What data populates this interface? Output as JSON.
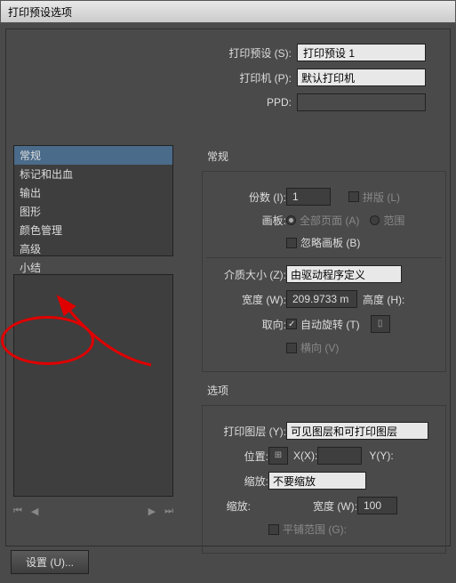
{
  "window": {
    "title": "打印预设选项"
  },
  "top": {
    "preset_label": "打印预设 (S):",
    "preset_value": "打印预设 1",
    "printer_label": "打印机 (P):",
    "printer_value": "默认打印机",
    "ppd_label": "PPD:"
  },
  "sidebar": {
    "items": [
      "常规",
      "标记和出血",
      "输出",
      "图形",
      "颜色管理",
      "高级",
      "小结"
    ]
  },
  "nav": {
    "first": "⏮",
    "prev": "◀",
    "next": "▶",
    "last": "⏭"
  },
  "general": {
    "title": "常规",
    "copies_label": "份数 (I):",
    "copies_value": "1",
    "collate_label": "拼版 (L)",
    "artboard_label": "画板:",
    "all_label": "全部页面 (A)",
    "range_label": "范围",
    "ignore_label": "忽略画板 (B)",
    "media_label": "介质大小 (Z):",
    "media_value": "由驱动程序定义",
    "width_label": "宽度 (W):",
    "width_value": "209.9733 m",
    "height_label": "高度 (H):",
    "orient_label": "取向:",
    "auto_label": "自动旋转 (T)",
    "landscape_label": "横向 (V)"
  },
  "options": {
    "title": "选项",
    "layers_label": "打印图层 (Y):",
    "layers_value": "可见图层和可打印图层",
    "placement_label": "位置:",
    "x_label": "X(X):",
    "y_label": "Y(Y):",
    "scale_label": "缩放:",
    "scale_value": "不要缩放",
    "scale2_label": "缩放:",
    "width2_label": "宽度 (W):",
    "width2_value": "100",
    "tile_label": "平铺范围 (G):"
  },
  "bottom": {
    "setup": "设置 (U)..."
  }
}
